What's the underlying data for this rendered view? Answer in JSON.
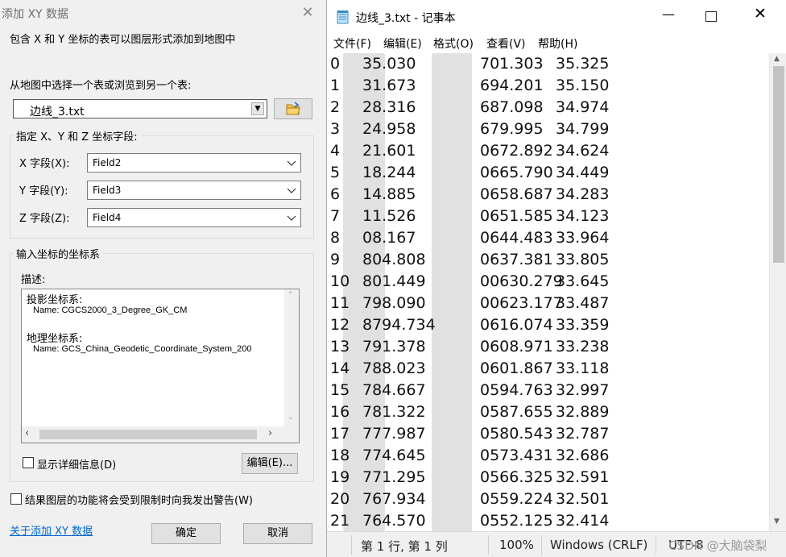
{
  "dialog": {
    "title": "添加 XY 数据",
    "intro": "包含 X 和 Y 坐标的表可以图层形式添加到地图中",
    "choose_label": "从地图中选择一个表或浏览到另一个表:",
    "table_value": "边线_3.txt",
    "fields_group": "指定 X、Y 和 Z 坐标字段:",
    "x_label": "X 字段(X):",
    "x_value": "Field2",
    "y_label": "Y 字段(Y):",
    "y_value": "Field3",
    "z_label": "Z 字段(Z):",
    "z_value": "Field4",
    "crs_group": "输入坐标的坐标系",
    "desc_label": "描述:",
    "proj_title": "投影坐标系:",
    "proj_name": "Name: CGCS2000_3_Degree_GK_CM",
    "geo_title": "地理坐标系:",
    "geo_name": "Name: GCS_China_Geodetic_Coordinate_System_200",
    "show_details": "显示详细信息(D)",
    "edit_button": "编辑(E)...",
    "warn_label": "结果图层的功能将会受到限制时向我发出警告(W)",
    "help_link": "关于添加 XY 数据",
    "ok_button": "确定",
    "cancel_button": "取消"
  },
  "notepad": {
    "title": "边线_3.txt - 记事本",
    "menus": [
      "文件(F)",
      "编辑(E)",
      "格式(O)",
      "查看(V)",
      "帮助(H)"
    ],
    "lines": [
      {
        "n": "0",
        "x": "35.030",
        "y": "701.303",
        "z": "35.325"
      },
      {
        "n": "1",
        "x": "31.673",
        "y": "694.201",
        "z": "35.150"
      },
      {
        "n": "2",
        "x": "28.316",
        "y": "687.098",
        "z": "34.974"
      },
      {
        "n": "3",
        "x": "24.958",
        "y": "679.995",
        "z": "34.799"
      },
      {
        "n": "4",
        "x": "21.601",
        "y": "0672.892",
        "z": "34.624"
      },
      {
        "n": "5",
        "x": "18.244",
        "y": "0665.790",
        "z": "34.449"
      },
      {
        "n": "6",
        "x": "14.885",
        "y": "0658.687",
        "z": "34.283"
      },
      {
        "n": "7",
        "x": "11.526",
        "y": "0651.585",
        "z": "34.123"
      },
      {
        "n": "8",
        "x": "08.167",
        "y": "0644.483",
        "z": "33.964"
      },
      {
        "n": "9",
        "x": "804.808",
        "y": "0637.381",
        "z": "33.805"
      },
      {
        "n": "10",
        "x": "801.449",
        "y": "00630.279",
        "z": "33.645"
      },
      {
        "n": "11",
        "x": "798.090",
        "y": "00623.177",
        "z": "33.487"
      },
      {
        "n": "12",
        "x": "8794.734",
        "y": "0616.074",
        "z": "33.359"
      },
      {
        "n": "13",
        "x": "791.378",
        "y": "0608.971",
        "z": "33.238"
      },
      {
        "n": "14",
        "x": "788.023",
        "y": "0601.867",
        "z": "33.118"
      },
      {
        "n": "15",
        "x": "784.667",
        "y": "0594.763",
        "z": "32.997"
      },
      {
        "n": "16",
        "x": "781.322",
        "y": "0587.655",
        "z": "32.889"
      },
      {
        "n": "17",
        "x": "777.987",
        "y": "0580.543",
        "z": "32.787"
      },
      {
        "n": "18",
        "x": "774.645",
        "y": "0573.431",
        "z": "32.686"
      },
      {
        "n": "19",
        "x": "771.295",
        "y": "0566.325",
        "z": "32.591"
      },
      {
        "n": "20",
        "x": "767.934",
        "y": "0559.224",
        "z": "32.501"
      },
      {
        "n": "21",
        "x": "764.570",
        "y": "0552.125",
        "z": "32.414"
      }
    ],
    "status_pos": "第 1 行, 第 1 列",
    "status_zoom": "100%",
    "status_eol": "Windows (CRLF)",
    "status_enc": "UTF-8",
    "watermark": "CSDN @大脑袋梨"
  }
}
